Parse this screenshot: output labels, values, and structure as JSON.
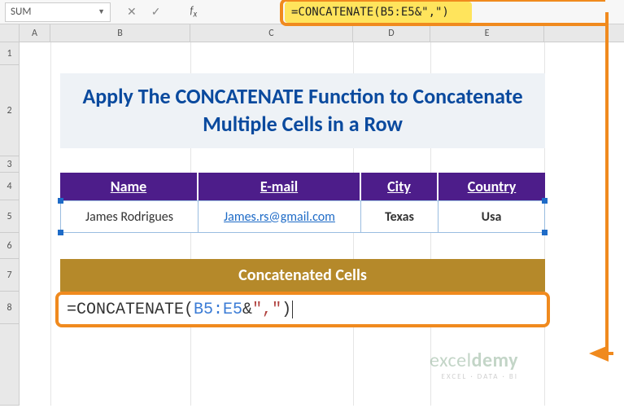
{
  "namebox": {
    "value": "SUM"
  },
  "formula_bar": {
    "formula": "=CONCATENATE(B5:E5&\",\")"
  },
  "columns": {
    "A": "A",
    "B": "B",
    "C": "C",
    "D": "D",
    "E": "E"
  },
  "rows": [
    "1",
    "2",
    "3",
    "4",
    "5",
    "6",
    "7",
    "8"
  ],
  "title": "Apply The CONCATENATE Function to Concatenate Multiple Cells in a Row",
  "headers": {
    "name": "Name",
    "email": "E-mail",
    "city": "City",
    "country": "Country"
  },
  "data_row": {
    "name": "James Rodrigues",
    "email": "James.rs@gmail.com",
    "city": "Texas",
    "country": "Usa"
  },
  "concat_header": "Concatenated Cells",
  "formula_cell": {
    "prefix": "=CONCATENATE(",
    "ref": "B5:E5",
    "op": "&",
    "str": "\",\"",
    "suffix": ")"
  },
  "watermark": {
    "brand_a": "excel",
    "brand_b": "demy",
    "tag": "EXCEL · DATA · BI"
  }
}
